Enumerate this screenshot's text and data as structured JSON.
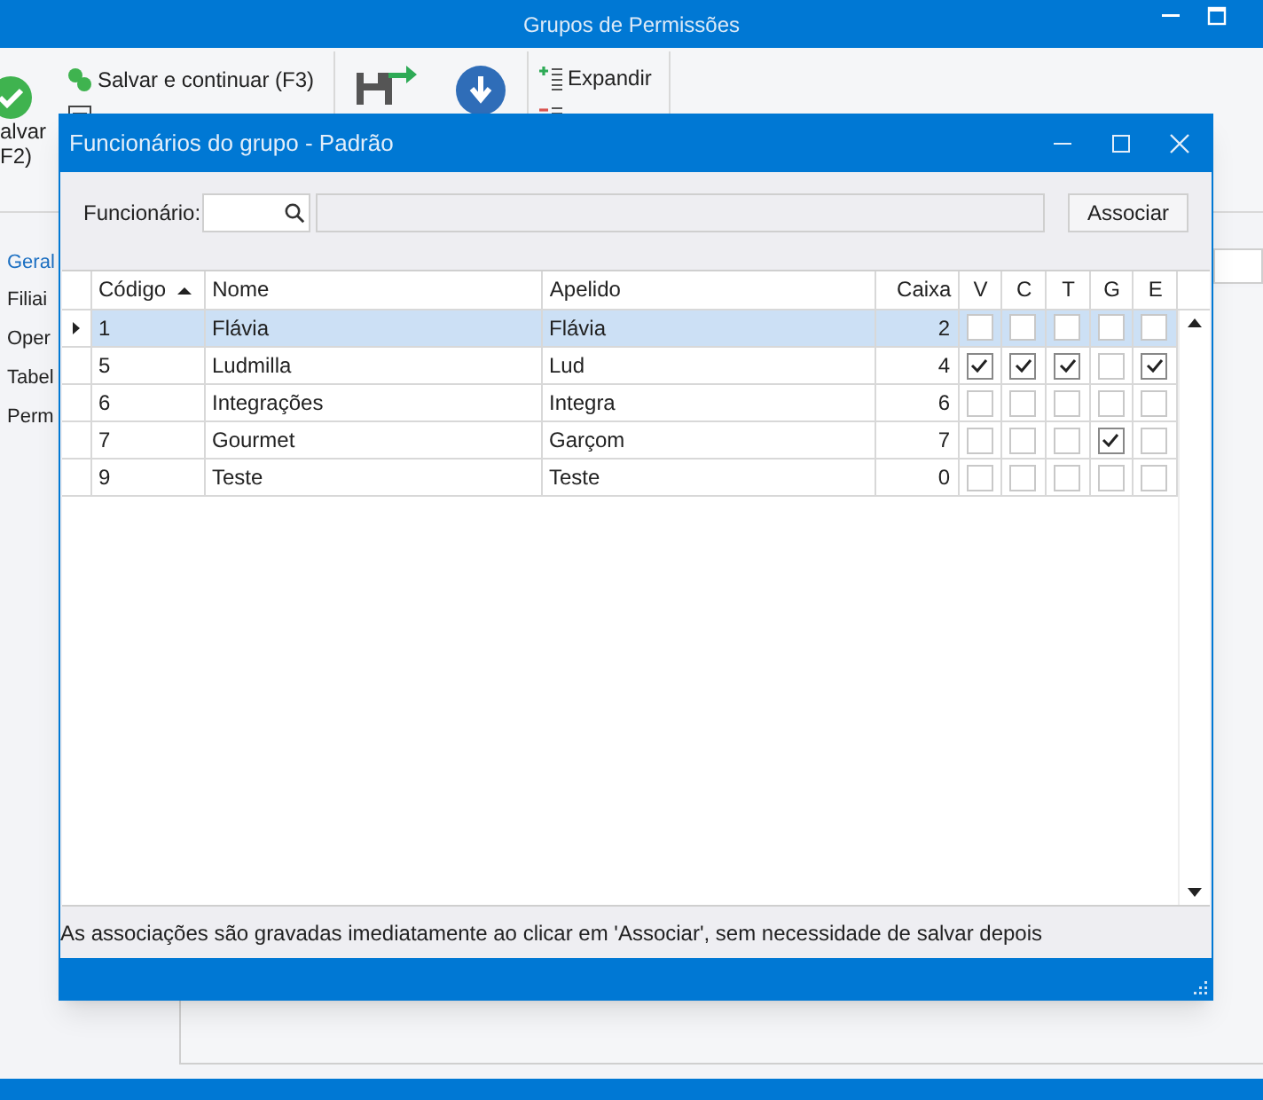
{
  "window": {
    "title": "Grupos de Permissões"
  },
  "ribbon": {
    "save_lines": [
      "alvar",
      "F2)"
    ],
    "small_buttons": [
      {
        "label": "Salvar e continuar (F3)"
      }
    ],
    "outline_buttons": [
      {
        "label": "Expandir"
      }
    ]
  },
  "sidebar": {
    "tabs": [
      {
        "label": "Geral",
        "selected": true
      }
    ],
    "items": [
      {
        "label": "Filiai"
      },
      {
        "label": "Oper"
      },
      {
        "label": "Tabel"
      },
      {
        "label": "Perm"
      }
    ]
  },
  "dialog": {
    "title": "Funcionários do grupo - Padrão",
    "filter_label": "Funcionário:",
    "button": "Associar",
    "columns": [
      {
        "label": "Código",
        "sorted": true,
        "kind": "text"
      },
      {
        "label": "Nome",
        "sorted": false,
        "kind": "text"
      },
      {
        "label": "Apelido",
        "sorted": false,
        "kind": "text"
      },
      {
        "label": "Caixa",
        "sorted": false,
        "kind": "number"
      },
      {
        "label": "V",
        "sorted": false,
        "kind": "check"
      },
      {
        "label": "C",
        "sorted": false,
        "kind": "check"
      },
      {
        "label": "T",
        "sorted": false,
        "kind": "check"
      },
      {
        "label": "G",
        "sorted": false,
        "kind": "check"
      },
      {
        "label": "E",
        "sorted": false,
        "kind": "check"
      }
    ],
    "rows": [
      {
        "selected": true,
        "cells": [
          "1",
          "Flávia",
          "Flávia",
          "2"
        ],
        "checks": [
          false,
          false,
          false,
          false,
          false
        ]
      },
      {
        "selected": false,
        "cells": [
          "5",
          "Ludmilla",
          "Lud",
          "4"
        ],
        "checks": [
          true,
          true,
          true,
          false,
          true
        ]
      },
      {
        "selected": false,
        "cells": [
          "6",
          "Integrações",
          "Integra",
          "6"
        ],
        "checks": [
          false,
          false,
          false,
          false,
          false
        ]
      },
      {
        "selected": false,
        "cells": [
          "7",
          "Gourmet",
          "Garçom",
          "7"
        ],
        "checks": [
          false,
          false,
          false,
          true,
          false
        ]
      },
      {
        "selected": false,
        "cells": [
          "9",
          "Teste",
          "Teste",
          "0"
        ],
        "checks": [
          false,
          false,
          false,
          false,
          false
        ]
      }
    ],
    "note": "As associações são gravadas imediatamente ao clicar em 'Associar', sem necessidade de salvar depois"
  }
}
